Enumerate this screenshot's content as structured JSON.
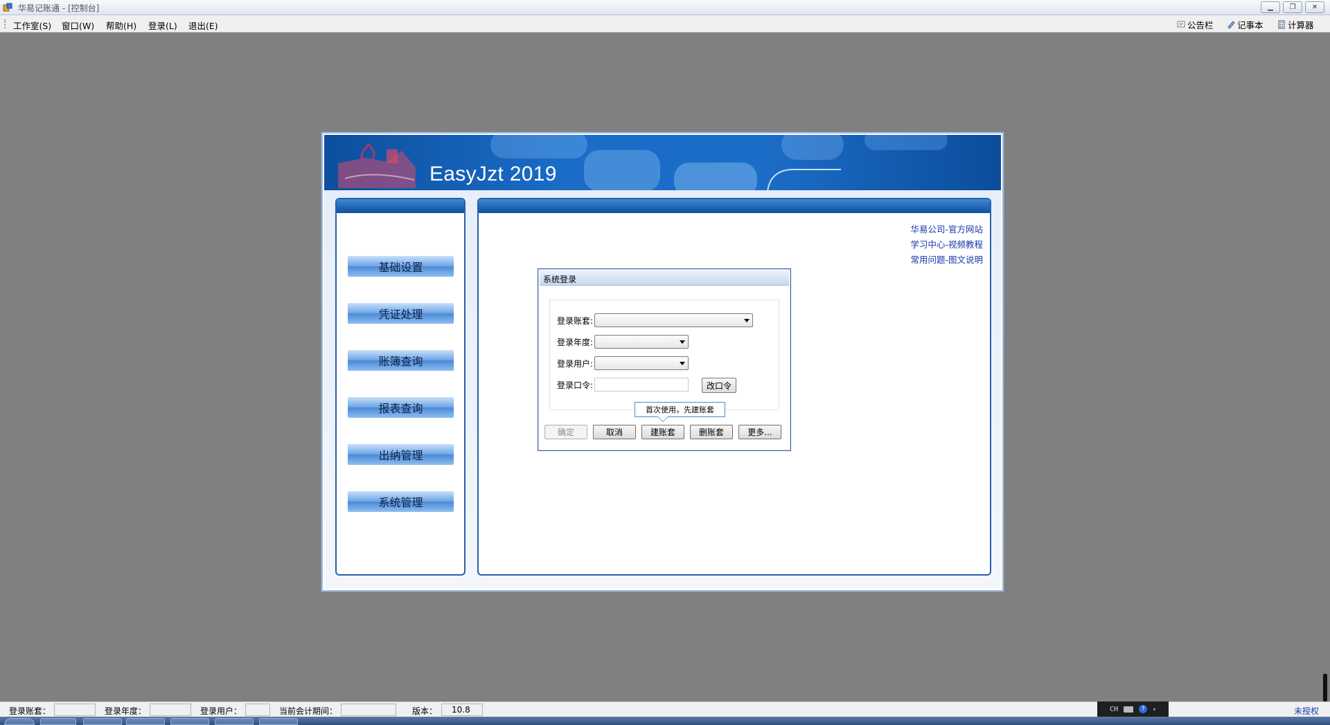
{
  "window": {
    "title": "华易记账通 - [控制台]",
    "buttons": [
      "minimize",
      "restore",
      "close"
    ]
  },
  "menu": {
    "items": [
      "工作室(S)",
      "窗口(W)",
      "帮助(H)",
      "登录(L)",
      "退出(E)"
    ],
    "tools": [
      {
        "label": "公告栏",
        "icon": "bulletin-icon"
      },
      {
        "label": "记事本",
        "icon": "notepad-icon"
      },
      {
        "label": "计算器",
        "icon": "calculator-icon"
      }
    ]
  },
  "banner": {
    "title": "EasyJzt 2019"
  },
  "nav": {
    "items": [
      "基础设置",
      "凭证处理",
      "账簿查询",
      "报表查询",
      "出纳管理",
      "系统管理"
    ]
  },
  "links": [
    "华易公司-官方网站",
    "学习中心-视频教程",
    "常用问题-图文说明"
  ],
  "login": {
    "title": "系统登录",
    "fields": {
      "account_label": "登录账套:",
      "account_value": "",
      "year_label": "登录年度:",
      "year_value": "",
      "user_label": "登录用户:",
      "user_value": "",
      "password_label": "登录口令:",
      "password_value": ""
    },
    "change_password": "改口令",
    "tooltip": "首次使用，先建账套",
    "buttons": {
      "ok": "确定",
      "cancel": "取消",
      "create": "建账套",
      "delete": "删账套",
      "more": "更多..."
    }
  },
  "status": {
    "account_label": "登录账套：",
    "account_value": "",
    "year_label": "登录年度：",
    "year_value": "",
    "user_label": "登录用户：",
    "user_value": "",
    "period_label": "当前会计期间：",
    "period_value": "",
    "version_label": "版本：",
    "version_value": "10.8",
    "license": "未授权"
  },
  "ime": {
    "text": "CH"
  },
  "colors": {
    "banner": "#1a6cc7",
    "panel_border": "#2a5fa8",
    "link": "#1737a8",
    "background": "#808080"
  }
}
